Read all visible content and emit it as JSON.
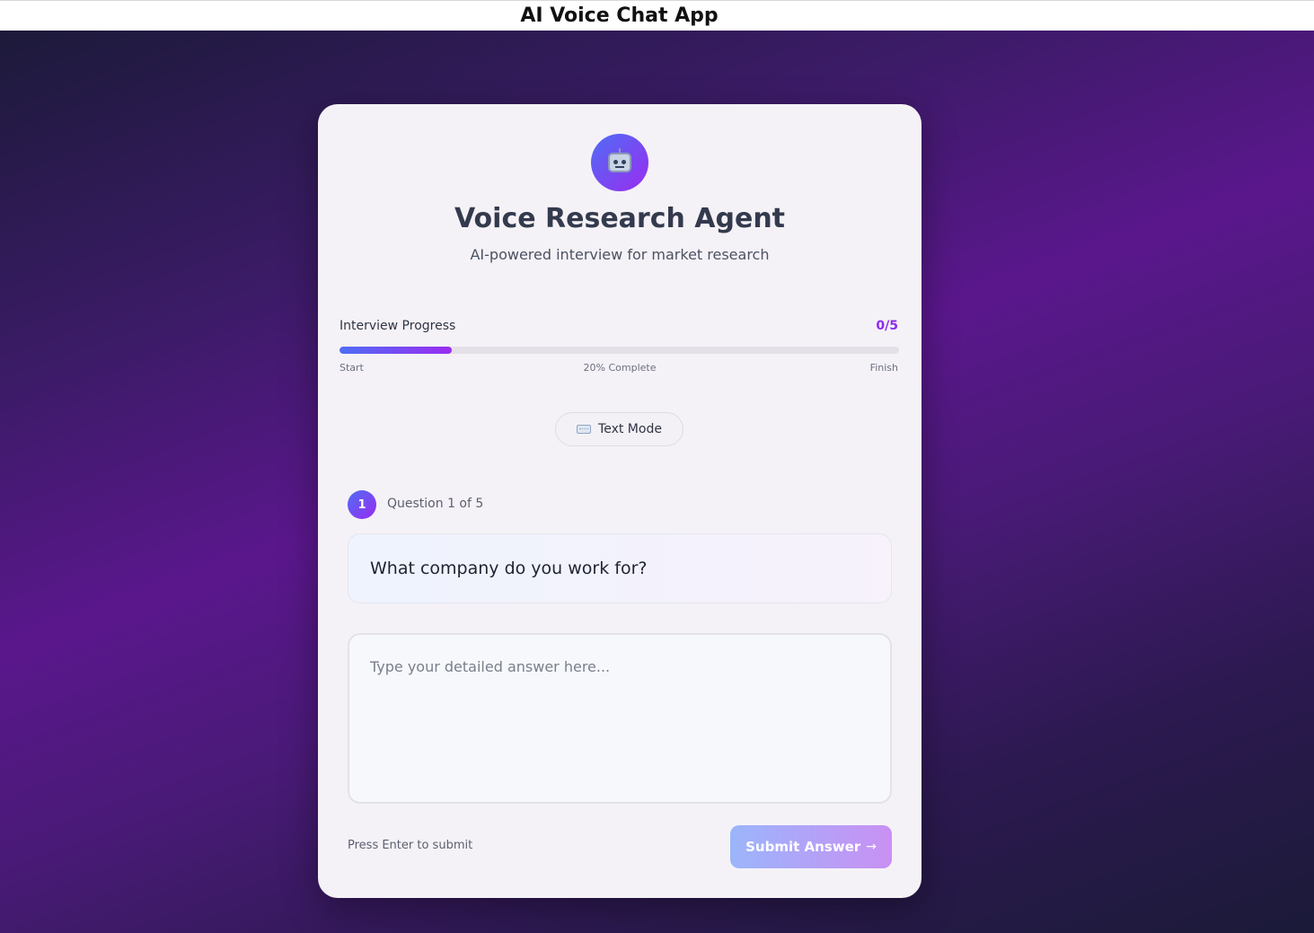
{
  "window": {
    "title": "AI Voice Chat App"
  },
  "header": {
    "avatar_icon": "robot-icon",
    "title": "Voice Research Agent",
    "subtitle": "AI-powered interview for market research"
  },
  "progress": {
    "label": "Interview Progress",
    "count": "0/5",
    "percent": 20,
    "start_label": "Start",
    "complete_label": "20% Complete",
    "finish_label": "Finish"
  },
  "mode": {
    "icon": "keyboard-icon",
    "label": "Text Mode"
  },
  "question": {
    "number": "1",
    "counter": "Question 1 of 5",
    "text": "What company do you work for?"
  },
  "answer": {
    "value": "",
    "placeholder": "Type your detailed answer here..."
  },
  "footer": {
    "hint": "Press Enter to submit",
    "submit_label": "Submit Answer",
    "submit_icon": "→"
  },
  "colors": {
    "accent_start": "#4f6df5",
    "accent_end": "#9a2cf0",
    "count_color": "#8b2cef"
  }
}
